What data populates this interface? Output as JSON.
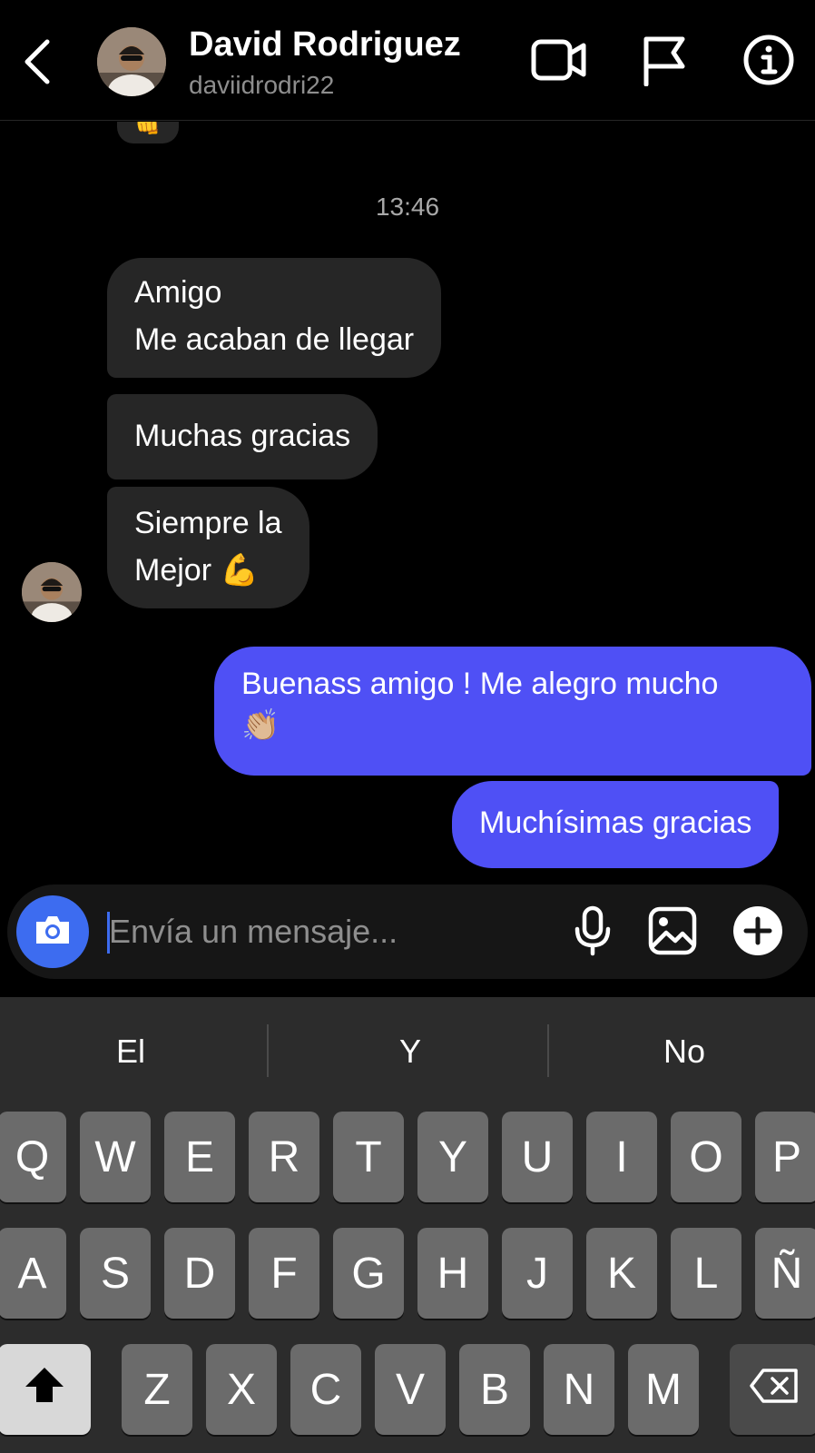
{
  "header": {
    "name": "David Rodriguez",
    "handle": "daviidrodri22",
    "icons": [
      "back-icon",
      "video-call-icon",
      "flag-icon",
      "info-icon"
    ]
  },
  "chat": {
    "partial_reaction": "👊",
    "timestamp": "13:46",
    "incoming": [
      {
        "line1": "Amigo",
        "line2": "Me acaban de llegar"
      },
      {
        "line1": "Muchas gracias"
      },
      {
        "line1": "Siempre la",
        "line2": "Mejor 💪"
      }
    ],
    "outgoing": [
      {
        "line1": "Buenass amigo ! Me alegro mucho",
        "line2": "👏🏼"
      },
      {
        "line1": "Muchísimas gracias"
      }
    ]
  },
  "composer": {
    "placeholder": "Envía un mensaje...",
    "icons": [
      "camera-icon",
      "microphone-icon",
      "gallery-icon",
      "add-icon"
    ]
  },
  "keyboard": {
    "suggestions": [
      "El",
      "Y",
      "No"
    ],
    "row1": [
      "Q",
      "W",
      "E",
      "R",
      "T",
      "Y",
      "U",
      "I",
      "O",
      "P"
    ],
    "row2": [
      "A",
      "S",
      "D",
      "F",
      "G",
      "H",
      "J",
      "K",
      "L",
      "Ñ"
    ],
    "row3": [
      "Z",
      "X",
      "C",
      "V",
      "B",
      "N",
      "M"
    ]
  },
  "colors": {
    "background": "#000000",
    "incoming_bubble": "#262626",
    "outgoing_bubble": "#4f50f5",
    "accent": "#3d6cf0",
    "keyboard_bg": "#2c2c2c",
    "key_bg": "#6b6b6b"
  }
}
